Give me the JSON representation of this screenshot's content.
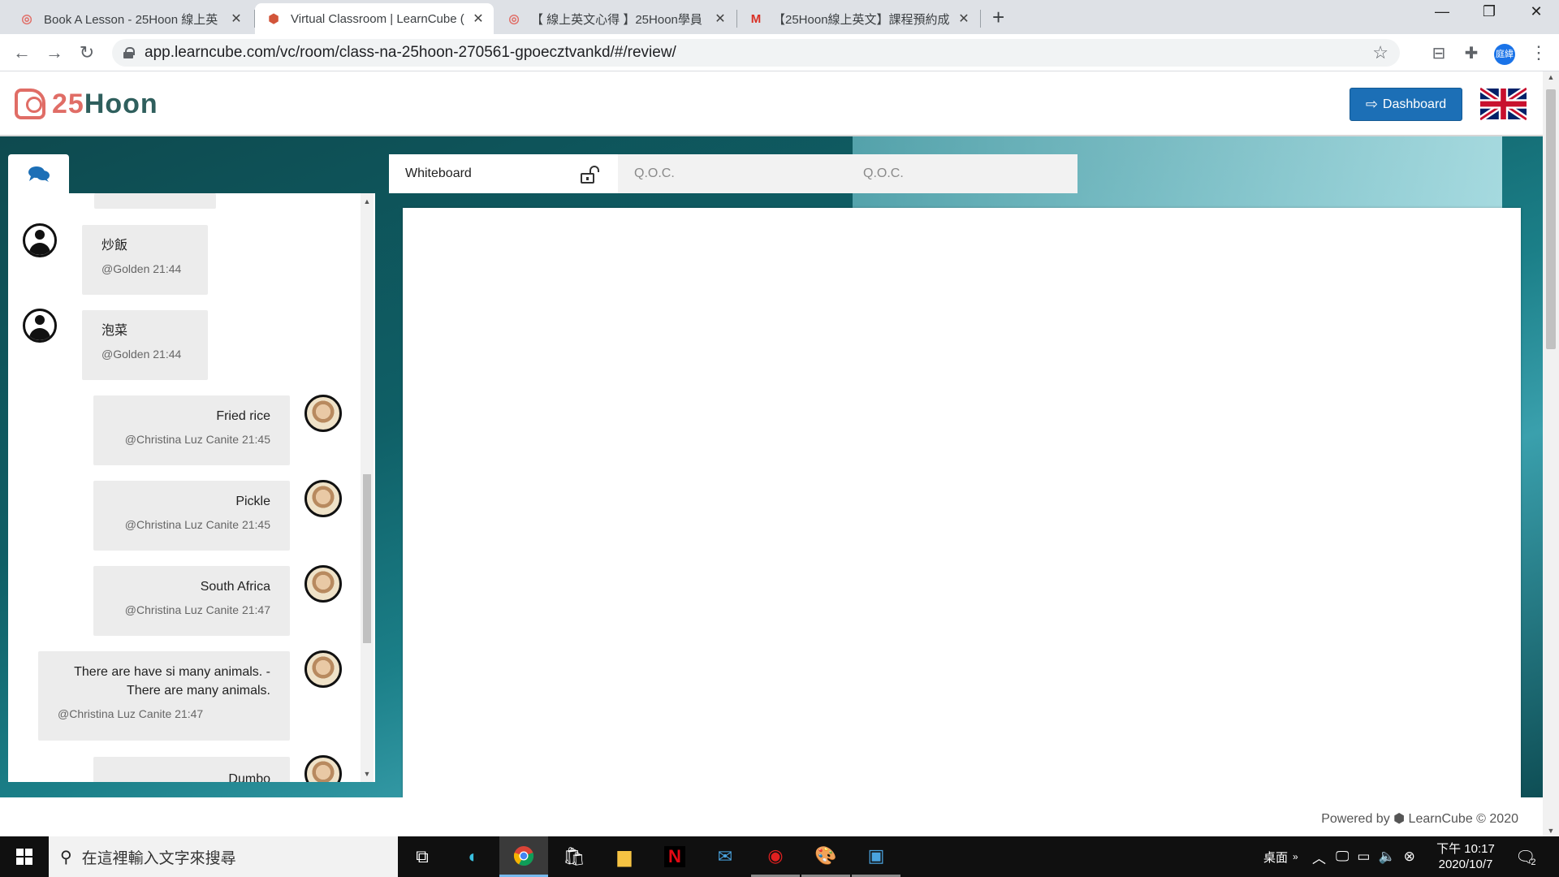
{
  "browser": {
    "tabs": [
      {
        "title": "Book A Lesson - 25Hoon 線上英",
        "active": false
      },
      {
        "title": "Virtual Classroom | LearnCube (",
        "active": true
      },
      {
        "title": "【 線上英文心得 】25Hoon學員",
        "active": false
      },
      {
        "title": "【25Hoon線上英文】課程預約成",
        "active": false
      }
    ],
    "url": "app.learncube.com/vc/room/class-na-25hoon-270561-gpoecztvankd/#/review/",
    "profile_initials": "庭緯"
  },
  "header": {
    "logo_text_num": "25",
    "logo_text_word": "Hoon",
    "dashboard_label": "Dashboard"
  },
  "chat": {
    "messages": [
      {
        "text": "炒飯",
        "meta": "@Golden 21:44",
        "side": "left"
      },
      {
        "text": "泡菜",
        "meta": "@Golden 21:44",
        "side": "left"
      },
      {
        "text": "Fried rice",
        "meta": "@Christina Luz Canite 21:45",
        "side": "right"
      },
      {
        "text": "Pickle",
        "meta": "@Christina Luz Canite 21:45",
        "side": "right"
      },
      {
        "text": "South Africa",
        "meta": "@Christina Luz Canite 21:47",
        "side": "right"
      },
      {
        "text_line1": "There are have si many animals. -",
        "text_line2": "There are many animals.",
        "meta": "@Christina Luz Canite 21:47",
        "side": "right"
      },
      {
        "text": "Dumbo",
        "side": "right"
      }
    ]
  },
  "board_tabs": [
    {
      "label": "Whiteboard",
      "active": true
    },
    {
      "label": "Q.O.C.",
      "active": false
    },
    {
      "label": "Q.O.C.",
      "active": false
    }
  ],
  "footer": {
    "powered": "Powered by ⬢ LearnCube © 2020"
  },
  "taskbar": {
    "search_placeholder": "在這裡輸入文字來搜尋",
    "desktop_label": "桌面",
    "time": "下午 10:17",
    "date": "2020/10/7",
    "notification_count": "2"
  },
  "colors": {
    "brand_red": "#e06d66",
    "brand_green": "#2f5f5d",
    "dashboard_blue": "#1c6fb6"
  }
}
